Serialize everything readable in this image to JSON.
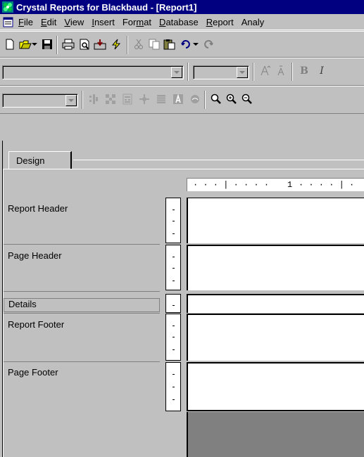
{
  "window": {
    "title": "Crystal Reports for Blackbaud - [Report1]"
  },
  "menu": {
    "items": [
      {
        "label": "File",
        "accel": "F"
      },
      {
        "label": "Edit",
        "accel": "E"
      },
      {
        "label": "View",
        "accel": "V"
      },
      {
        "label": "Insert",
        "accel": "I"
      },
      {
        "label": "Format",
        "accel": "m"
      },
      {
        "label": "Database",
        "accel": "D"
      },
      {
        "label": "Report",
        "accel": "R"
      },
      {
        "label": "Analy",
        "accel": ""
      }
    ]
  },
  "toolbar": {
    "icons": [
      "new-icon",
      "open-icon",
      "save-icon",
      "print-icon",
      "print-preview-icon",
      "export-icon",
      "refresh-icon",
      "cut-icon",
      "copy-icon",
      "paste-icon",
      "undo-icon",
      "redo-icon"
    ],
    "format_icons": [
      "increase-font-icon",
      "decrease-font-icon",
      "bold-icon",
      "italic-icon"
    ],
    "bold_label": "B",
    "italic_label": "I",
    "font_name": "",
    "font_size": ""
  },
  "tabs": {
    "design": "Design"
  },
  "ruler": {
    "marker": "1"
  },
  "sections": [
    {
      "name": "Report Header"
    },
    {
      "name": "Page Header"
    },
    {
      "name": "Details"
    },
    {
      "name": "Report Footer"
    },
    {
      "name": "Page Footer"
    }
  ]
}
